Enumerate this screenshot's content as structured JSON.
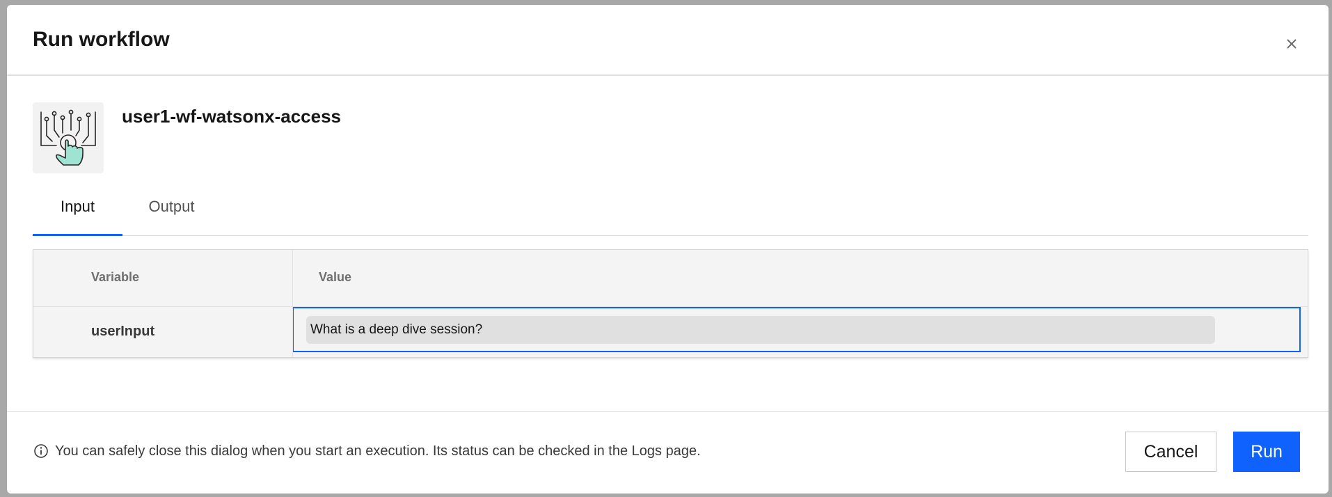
{
  "dialog": {
    "title": "Run workflow",
    "close_icon": "close-icon"
  },
  "workflow": {
    "name": "user1-wf-watsonx-access",
    "icon": "touch-circuit-icon",
    "icon_accent": "#9fe3d2"
  },
  "tabs": [
    {
      "label": "Input",
      "active": true
    },
    {
      "label": "Output",
      "active": false
    }
  ],
  "table": {
    "headers": {
      "variable": "Variable",
      "value": "Value"
    },
    "rows": [
      {
        "variable": "userInput",
        "value": "What is a deep dive session?"
      }
    ]
  },
  "footer": {
    "info_icon": "info-icon",
    "info_text": "You can safely close this dialog when you start an execution. Its status can be checked in the Logs page.",
    "cancel_label": "Cancel",
    "run_label": "Run"
  },
  "colors": {
    "accent": "#0f62fe",
    "header_bg": "#f4f4f4",
    "input_bg": "#e0e0e0"
  }
}
